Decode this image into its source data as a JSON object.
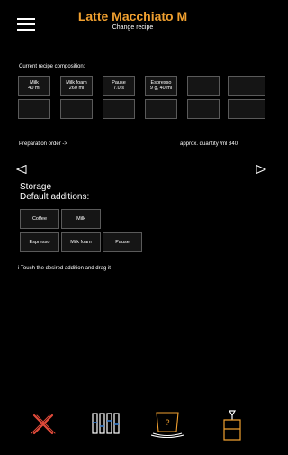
{
  "header": {
    "title": "Latte Macchiato M",
    "subtitle": "Change recipe",
    "menu_icon": "hamburger-menu-icon"
  },
  "composition": {
    "label": "Current recipe composition:",
    "cells": [
      {
        "name": "Milk",
        "value": "40 ml"
      },
      {
        "name": "Milk foam",
        "value": "260 ml"
      },
      {
        "name": "Pause",
        "value": "7.0 s"
      },
      {
        "name": "Espresso",
        "value": "9 g, 40 ml"
      },
      {
        "name": "",
        "value": ""
      },
      {
        "name": "",
        "value": ""
      }
    ]
  },
  "order": {
    "label": "Preparation order ->",
    "quantity": "approx. quantity /ml 340"
  },
  "storage": {
    "title": "Storage",
    "subtitle": "Default additions:",
    "row1": [
      "Coffee",
      "Milk"
    ],
    "row2": [
      "Espresso",
      "Milk foam",
      "Pause"
    ]
  },
  "hint": "i Touch the desired addition and drag it",
  "colors": {
    "accent": "#f0a030",
    "cancel": "#e04a3a",
    "cell_border": "#5a5a5a",
    "blue_line": "#3a7fd0"
  },
  "bottom_icons": [
    "cancel-x-icon",
    "adjust-sliders-icon",
    "coffee-cup-icon",
    "cup-download-icon"
  ]
}
